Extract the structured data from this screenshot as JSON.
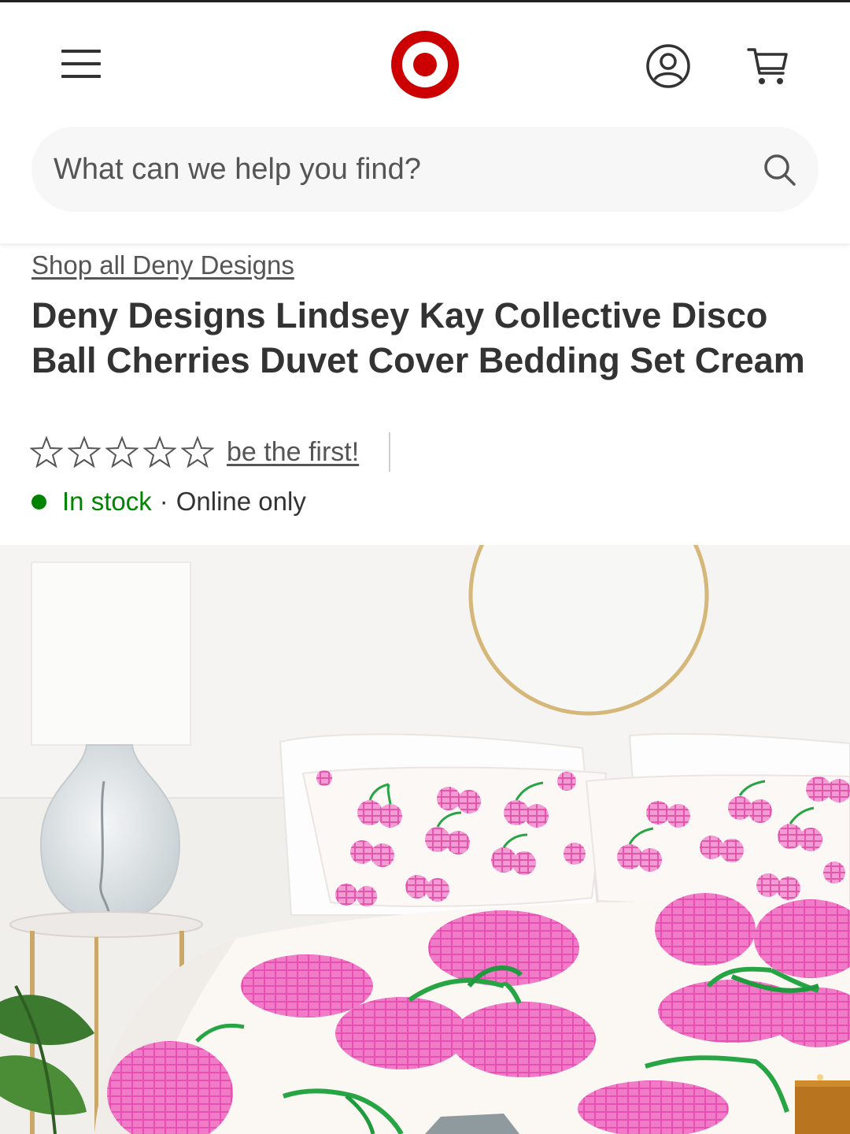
{
  "header": {
    "menu_icon": "hamburger-menu-icon",
    "logo": "target-bullseye-logo",
    "account_icon": "account-icon",
    "cart_icon": "cart-icon",
    "brand_color": "#cc0000"
  },
  "search": {
    "placeholder": "What can we help you find?",
    "icon": "search-icon"
  },
  "product": {
    "breadcrumb": "Shop all Deny Designs",
    "title": "Deny Designs Lindsey Kay Collective Disco Ball Cherries Duvet Cover Bedding Set Cream",
    "rating": {
      "stars": 0,
      "max_stars": 5,
      "link_text": "be the first!"
    },
    "availability": {
      "status": "In stock",
      "separator": "·",
      "channel": "Online only",
      "status_color": "#008300"
    }
  },
  "image": {
    "description_icon": "product-photo",
    "colors": {
      "pink": "#e94fb3",
      "green": "#27a544",
      "cream": "#fbf7f3"
    }
  }
}
